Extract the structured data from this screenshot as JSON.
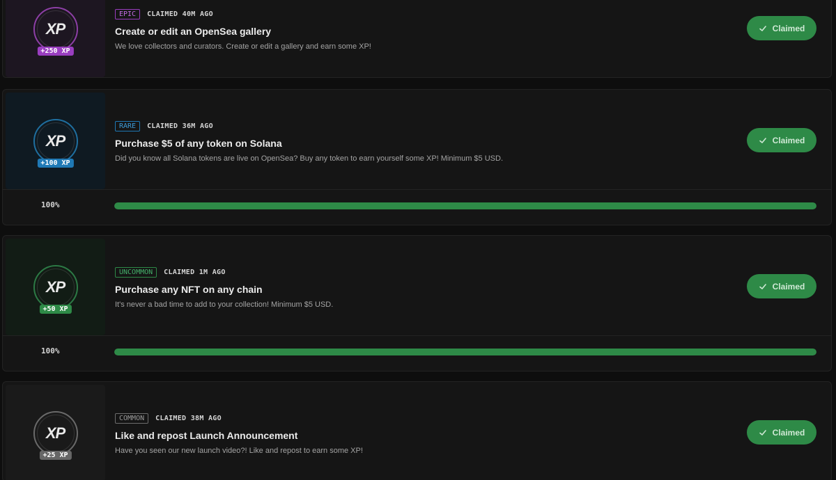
{
  "colors": {
    "claimed_button": "#2e8a47",
    "progress_fill": "#2e8a47",
    "epic": "#9a3ec0",
    "rare": "#1f79b5",
    "uncommon": "#2e8a47",
    "common": "#6d6d6d"
  },
  "quests": [
    {
      "rarity": "EPIC",
      "claimed_ago": "CLAIMED 40M AGO",
      "xp_label": "XP",
      "xp_reward": "+250 XP",
      "title": "Create or edit an OpenSea gallery",
      "description": "We love collectors and curators. Create or edit a gallery and earn some XP!",
      "button_label": "Claimed",
      "button_icon": "check-icon"
    },
    {
      "rarity": "RARE",
      "claimed_ago": "CLAIMED 36M AGO",
      "xp_label": "XP",
      "xp_reward": "+100 XP",
      "title": "Purchase $5 of any token on Solana",
      "description": "Did you know all Solana tokens are live on OpenSea? Buy any token to earn yourself some XP! Minimum $5 USD.",
      "button_label": "Claimed",
      "button_icon": "check-icon",
      "progress_label": "100%",
      "progress": 1.0
    },
    {
      "rarity": "UNCOMMON",
      "claimed_ago": "CLAIMED 1M AGO",
      "xp_label": "XP",
      "xp_reward": "+50 XP",
      "title": "Purchase any NFT on any chain",
      "description": "It's never a bad time to add to your collection! Minimum $5 USD.",
      "button_label": "Claimed",
      "button_icon": "check-icon",
      "progress_label": "100%",
      "progress": 1.0
    },
    {
      "rarity": "COMMON",
      "claimed_ago": "CLAIMED 38M AGO",
      "xp_label": "XP",
      "xp_reward": "+25 XP",
      "title": "Like and repost Launch Announcement",
      "description": "Have you seen our new launch video?! Like and repost to earn some XP!",
      "button_label": "Claimed",
      "button_icon": "check-icon"
    }
  ]
}
